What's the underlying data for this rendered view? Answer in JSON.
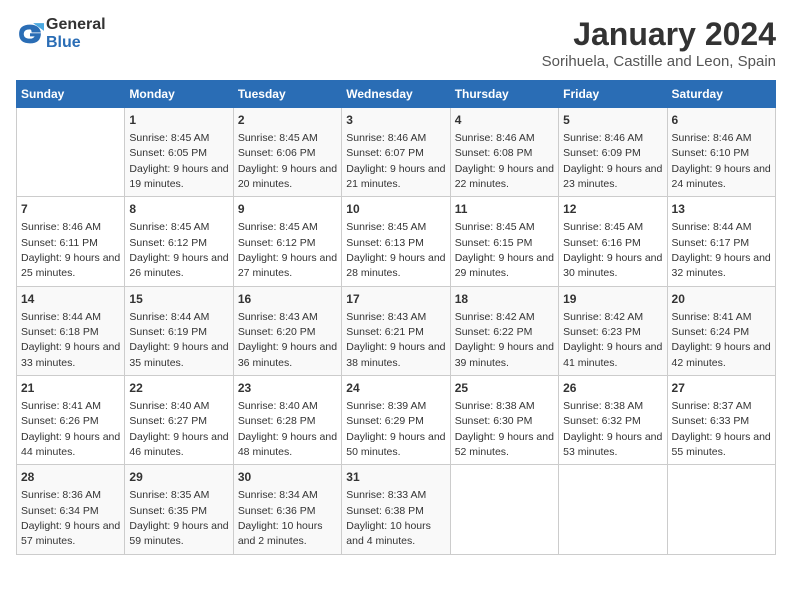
{
  "logo": {
    "line1": "General",
    "line2": "Blue"
  },
  "title": "January 2024",
  "subtitle": "Sorihuela, Castille and Leon, Spain",
  "days_of_week": [
    "Sunday",
    "Monday",
    "Tuesday",
    "Wednesday",
    "Thursday",
    "Friday",
    "Saturday"
  ],
  "weeks": [
    [
      {
        "day": "",
        "sunrise": "",
        "sunset": "",
        "daylight": ""
      },
      {
        "day": "1",
        "sunrise": "Sunrise: 8:45 AM",
        "sunset": "Sunset: 6:05 PM",
        "daylight": "Daylight: 9 hours and 19 minutes."
      },
      {
        "day": "2",
        "sunrise": "Sunrise: 8:45 AM",
        "sunset": "Sunset: 6:06 PM",
        "daylight": "Daylight: 9 hours and 20 minutes."
      },
      {
        "day": "3",
        "sunrise": "Sunrise: 8:46 AM",
        "sunset": "Sunset: 6:07 PM",
        "daylight": "Daylight: 9 hours and 21 minutes."
      },
      {
        "day": "4",
        "sunrise": "Sunrise: 8:46 AM",
        "sunset": "Sunset: 6:08 PM",
        "daylight": "Daylight: 9 hours and 22 minutes."
      },
      {
        "day": "5",
        "sunrise": "Sunrise: 8:46 AM",
        "sunset": "Sunset: 6:09 PM",
        "daylight": "Daylight: 9 hours and 23 minutes."
      },
      {
        "day": "6",
        "sunrise": "Sunrise: 8:46 AM",
        "sunset": "Sunset: 6:10 PM",
        "daylight": "Daylight: 9 hours and 24 minutes."
      }
    ],
    [
      {
        "day": "7",
        "sunrise": "Sunrise: 8:46 AM",
        "sunset": "Sunset: 6:11 PM",
        "daylight": "Daylight: 9 hours and 25 minutes."
      },
      {
        "day": "8",
        "sunrise": "Sunrise: 8:45 AM",
        "sunset": "Sunset: 6:12 PM",
        "daylight": "Daylight: 9 hours and 26 minutes."
      },
      {
        "day": "9",
        "sunrise": "Sunrise: 8:45 AM",
        "sunset": "Sunset: 6:12 PM",
        "daylight": "Daylight: 9 hours and 27 minutes."
      },
      {
        "day": "10",
        "sunrise": "Sunrise: 8:45 AM",
        "sunset": "Sunset: 6:13 PM",
        "daylight": "Daylight: 9 hours and 28 minutes."
      },
      {
        "day": "11",
        "sunrise": "Sunrise: 8:45 AM",
        "sunset": "Sunset: 6:15 PM",
        "daylight": "Daylight: 9 hours and 29 minutes."
      },
      {
        "day": "12",
        "sunrise": "Sunrise: 8:45 AM",
        "sunset": "Sunset: 6:16 PM",
        "daylight": "Daylight: 9 hours and 30 minutes."
      },
      {
        "day": "13",
        "sunrise": "Sunrise: 8:44 AM",
        "sunset": "Sunset: 6:17 PM",
        "daylight": "Daylight: 9 hours and 32 minutes."
      }
    ],
    [
      {
        "day": "14",
        "sunrise": "Sunrise: 8:44 AM",
        "sunset": "Sunset: 6:18 PM",
        "daylight": "Daylight: 9 hours and 33 minutes."
      },
      {
        "day": "15",
        "sunrise": "Sunrise: 8:44 AM",
        "sunset": "Sunset: 6:19 PM",
        "daylight": "Daylight: 9 hours and 35 minutes."
      },
      {
        "day": "16",
        "sunrise": "Sunrise: 8:43 AM",
        "sunset": "Sunset: 6:20 PM",
        "daylight": "Daylight: 9 hours and 36 minutes."
      },
      {
        "day": "17",
        "sunrise": "Sunrise: 8:43 AM",
        "sunset": "Sunset: 6:21 PM",
        "daylight": "Daylight: 9 hours and 38 minutes."
      },
      {
        "day": "18",
        "sunrise": "Sunrise: 8:42 AM",
        "sunset": "Sunset: 6:22 PM",
        "daylight": "Daylight: 9 hours and 39 minutes."
      },
      {
        "day": "19",
        "sunrise": "Sunrise: 8:42 AM",
        "sunset": "Sunset: 6:23 PM",
        "daylight": "Daylight: 9 hours and 41 minutes."
      },
      {
        "day": "20",
        "sunrise": "Sunrise: 8:41 AM",
        "sunset": "Sunset: 6:24 PM",
        "daylight": "Daylight: 9 hours and 42 minutes."
      }
    ],
    [
      {
        "day": "21",
        "sunrise": "Sunrise: 8:41 AM",
        "sunset": "Sunset: 6:26 PM",
        "daylight": "Daylight: 9 hours and 44 minutes."
      },
      {
        "day": "22",
        "sunrise": "Sunrise: 8:40 AM",
        "sunset": "Sunset: 6:27 PM",
        "daylight": "Daylight: 9 hours and 46 minutes."
      },
      {
        "day": "23",
        "sunrise": "Sunrise: 8:40 AM",
        "sunset": "Sunset: 6:28 PM",
        "daylight": "Daylight: 9 hours and 48 minutes."
      },
      {
        "day": "24",
        "sunrise": "Sunrise: 8:39 AM",
        "sunset": "Sunset: 6:29 PM",
        "daylight": "Daylight: 9 hours and 50 minutes."
      },
      {
        "day": "25",
        "sunrise": "Sunrise: 8:38 AM",
        "sunset": "Sunset: 6:30 PM",
        "daylight": "Daylight: 9 hours and 52 minutes."
      },
      {
        "day": "26",
        "sunrise": "Sunrise: 8:38 AM",
        "sunset": "Sunset: 6:32 PM",
        "daylight": "Daylight: 9 hours and 53 minutes."
      },
      {
        "day": "27",
        "sunrise": "Sunrise: 8:37 AM",
        "sunset": "Sunset: 6:33 PM",
        "daylight": "Daylight: 9 hours and 55 minutes."
      }
    ],
    [
      {
        "day": "28",
        "sunrise": "Sunrise: 8:36 AM",
        "sunset": "Sunset: 6:34 PM",
        "daylight": "Daylight: 9 hours and 57 minutes."
      },
      {
        "day": "29",
        "sunrise": "Sunrise: 8:35 AM",
        "sunset": "Sunset: 6:35 PM",
        "daylight": "Daylight: 9 hours and 59 minutes."
      },
      {
        "day": "30",
        "sunrise": "Sunrise: 8:34 AM",
        "sunset": "Sunset: 6:36 PM",
        "daylight": "Daylight: 10 hours and 2 minutes."
      },
      {
        "day": "31",
        "sunrise": "Sunrise: 8:33 AM",
        "sunset": "Sunset: 6:38 PM",
        "daylight": "Daylight: 10 hours and 4 minutes."
      },
      {
        "day": "",
        "sunrise": "",
        "sunset": "",
        "daylight": ""
      },
      {
        "day": "",
        "sunrise": "",
        "sunset": "",
        "daylight": ""
      },
      {
        "day": "",
        "sunrise": "",
        "sunset": "",
        "daylight": ""
      }
    ]
  ]
}
